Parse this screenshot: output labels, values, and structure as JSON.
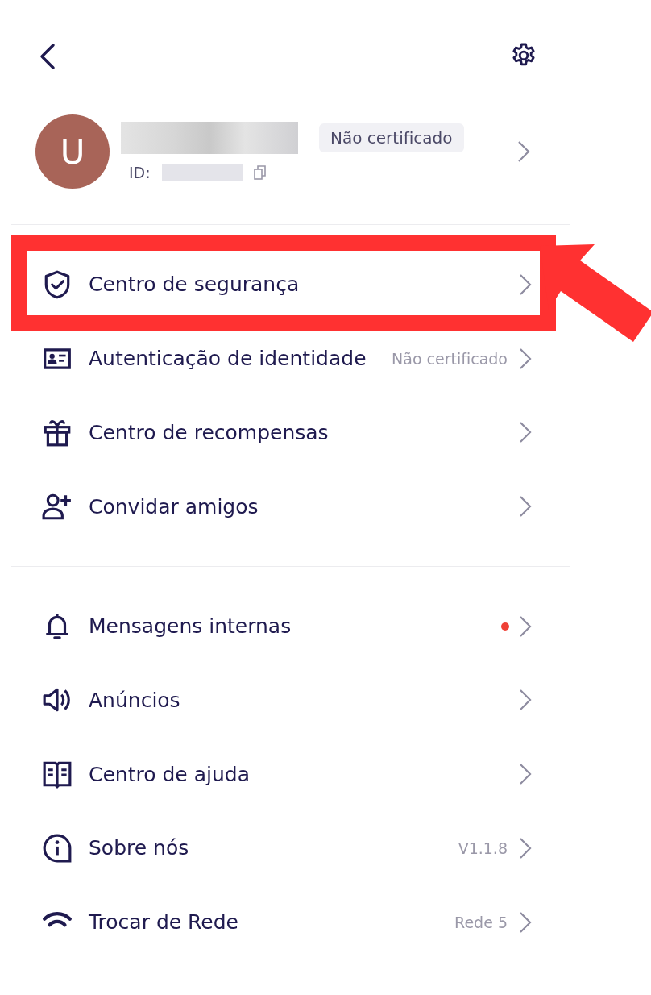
{
  "profile": {
    "avatar_letter": "U",
    "badge": "Não certificado",
    "id_label": "ID:"
  },
  "sections": [
    {
      "items": [
        {
          "label": "Centro de segurança",
          "highlighted": true
        },
        {
          "label": "Autenticação de identidade",
          "value": "Não certificado",
          "highlighted": false
        },
        {
          "label": "Centro de recompensas",
          "highlighted": false
        },
        {
          "label": "Convidar amigos",
          "highlighted": false
        }
      ]
    },
    {
      "items": [
        {
          "label": "Mensagens internas",
          "unread": true,
          "highlighted": false
        },
        {
          "label": "Anúncios",
          "unread": false,
          "highlighted": false
        },
        {
          "label": "Centro de ajuda",
          "unread": false,
          "highlighted": false
        },
        {
          "label": "Sobre nós",
          "value": "V1.1.8",
          "unread": false,
          "highlighted": false
        },
        {
          "label": "Trocar de Rede",
          "value": "Rede 5",
          "unread": false,
          "highlighted": false
        }
      ]
    }
  ]
}
